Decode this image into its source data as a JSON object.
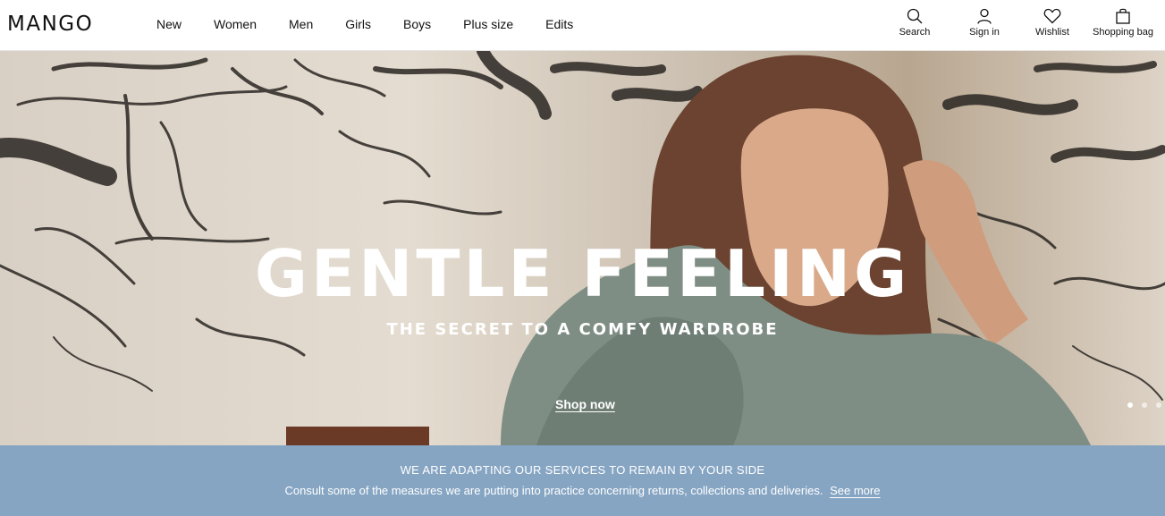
{
  "brand": {
    "logo": "MANGO"
  },
  "nav": {
    "items": [
      "New",
      "Women",
      "Men",
      "Girls",
      "Boys",
      "Plus size",
      "Edits"
    ]
  },
  "actions": {
    "search": "Search",
    "sign_in": "Sign in",
    "wishlist": "Wishlist",
    "bag": "Shopping bag"
  },
  "hero": {
    "title": "GENTLE FEELING",
    "subtitle": "THE SECRET TO A COMFY WARDROBE",
    "cta": "Shop now",
    "slides": {
      "count": 3,
      "active_index": 0
    }
  },
  "banner": {
    "title": "WE ARE ADAPTING OUR SERVICES TO REMAIN BY YOUR SIDE",
    "text": "Consult some of the measures we are putting into practice concerning returns, collections and deliveries.",
    "link": "See more"
  },
  "colors": {
    "banner_bg": "#86a5c3",
    "text": "#111111",
    "hero_text": "#ffffff"
  }
}
